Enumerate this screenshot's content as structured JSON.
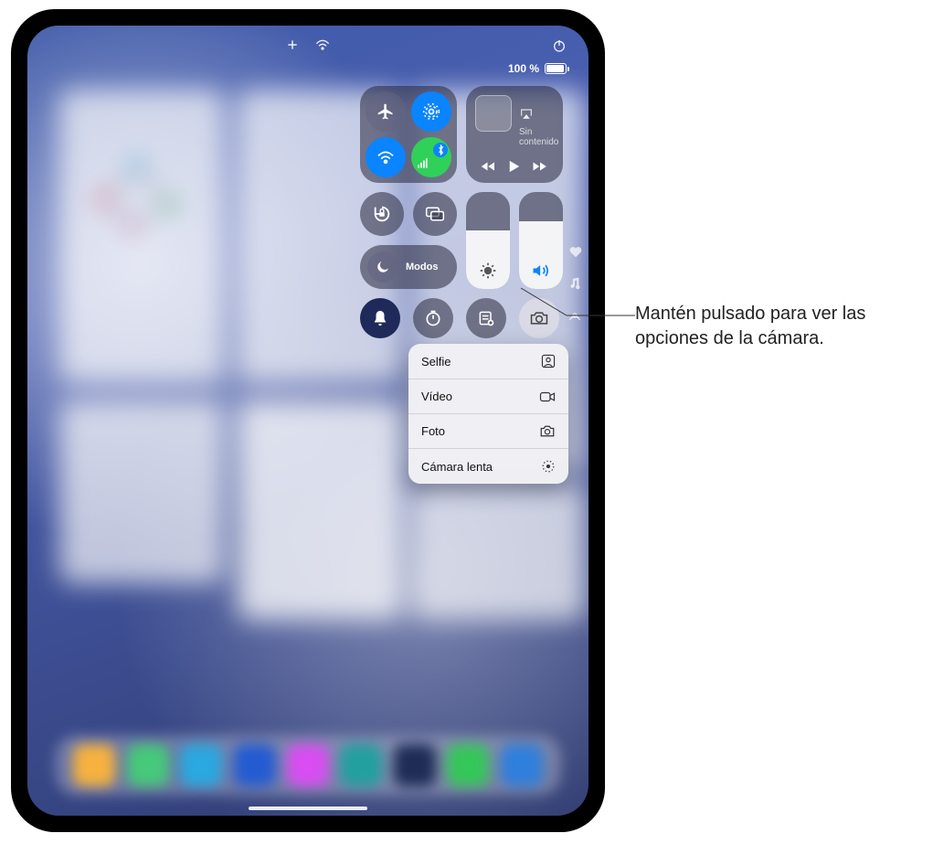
{
  "callout": {
    "text": "Mantén pulsado para ver las opciones de la cámara."
  },
  "status": {
    "battery_pct": "100 %"
  },
  "media": {
    "no_content": "Sin contenido"
  },
  "focus": {
    "label": "Modos"
  },
  "sliders": {
    "brightness_pct": 60,
    "volume_pct": 70
  },
  "camera_menu": {
    "items": [
      {
        "label": "Selfie",
        "icon": "person-square"
      },
      {
        "label": "Vídeo",
        "icon": "video"
      },
      {
        "label": "Foto",
        "icon": "camera"
      },
      {
        "label": "Cámara lenta",
        "icon": "slowmo"
      }
    ]
  },
  "dock_colors": [
    "#f6b23e",
    "#46c97a",
    "#2aa8e0",
    "#245bd1",
    "#d94df2",
    "#22a0a0",
    "#1f2d55",
    "#35c759",
    "#2f7fdc"
  ]
}
